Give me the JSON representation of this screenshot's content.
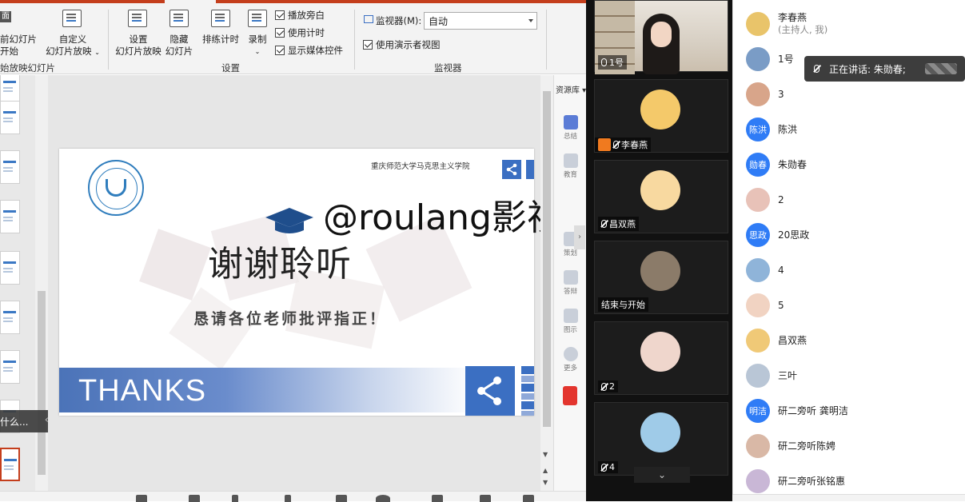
{
  "ribbon": {
    "btn_from_current_line1": "前幻灯片",
    "btn_from_current_line2": "开始",
    "btn_custom_line1": "自定义",
    "btn_custom_line2": "幻灯片放映",
    "grp_start_label": "始放映幻灯片",
    "btn_setup_line1": "设置",
    "btn_setup_line2": "幻灯片放映",
    "btn_hide_line1": "隐藏",
    "btn_hide_line2": "幻灯片",
    "btn_rehearse": "排练计时",
    "btn_record": "录制",
    "chk_narration": "播放旁白",
    "chk_timings": "使用计时",
    "chk_media": "显示媒体控件",
    "grp_setup_label": "设置",
    "monitor_label": "监视器(M):",
    "monitor_value": "自动",
    "chk_presenter": "使用演示者视图",
    "grp_monitor_label": "监视器",
    "top_fragment": "面"
  },
  "thumbs": {
    "search_tip": "什么..."
  },
  "slide": {
    "university": "重庆师范大学马克思主义学院",
    "title": "谢谢聆听",
    "subtitle": "恳请各位老师批评指正！",
    "thanks": "THANKS"
  },
  "watermark": "@roulang影视泛",
  "resource_panel": {
    "header": "资源库",
    "items": [
      "总结",
      "教育",
      "策划",
      "答辩",
      "图示",
      "更多"
    ]
  },
  "video": {
    "tiles": [
      {
        "label": "1号"
      },
      {
        "label": "李春燕"
      },
      {
        "label": "昌双燕"
      },
      {
        "label": "结束与开始"
      },
      {
        "label": "2"
      },
      {
        "label": "4"
      }
    ]
  },
  "participants": {
    "speaking_prefix": "正在讲话: 朱勋春;",
    "list": [
      {
        "name": "李春燕",
        "sub": "(主持人, 我)",
        "avatar": ""
      },
      {
        "name": "1号",
        "sub": "",
        "avatar": ""
      },
      {
        "name": "3",
        "sub": "",
        "avatar": ""
      },
      {
        "name": "陈洪",
        "sub": "",
        "avatar": "陈洪"
      },
      {
        "name": "朱勋春",
        "sub": "",
        "avatar": "勋春"
      },
      {
        "name": "2",
        "sub": "",
        "avatar": ""
      },
      {
        "name": "20思政",
        "sub": "",
        "avatar": "思政"
      },
      {
        "name": "4",
        "sub": "",
        "avatar": ""
      },
      {
        "name": "5",
        "sub": "",
        "avatar": ""
      },
      {
        "name": "昌双燕",
        "sub": "",
        "avatar": ""
      },
      {
        "name": "三叶",
        "sub": "",
        "avatar": ""
      },
      {
        "name": "研二旁听 龚明洁",
        "sub": "",
        "avatar": "明洁"
      },
      {
        "name": "研二旁听陈娉",
        "sub": "",
        "avatar": ""
      },
      {
        "name": "研二旁听张铭惠",
        "sub": "",
        "avatar": ""
      }
    ]
  },
  "colors": {
    "accent": "#c43e1c",
    "slide_blue": "#3b6fc2",
    "avatar_blue": "#2f7cf6"
  }
}
